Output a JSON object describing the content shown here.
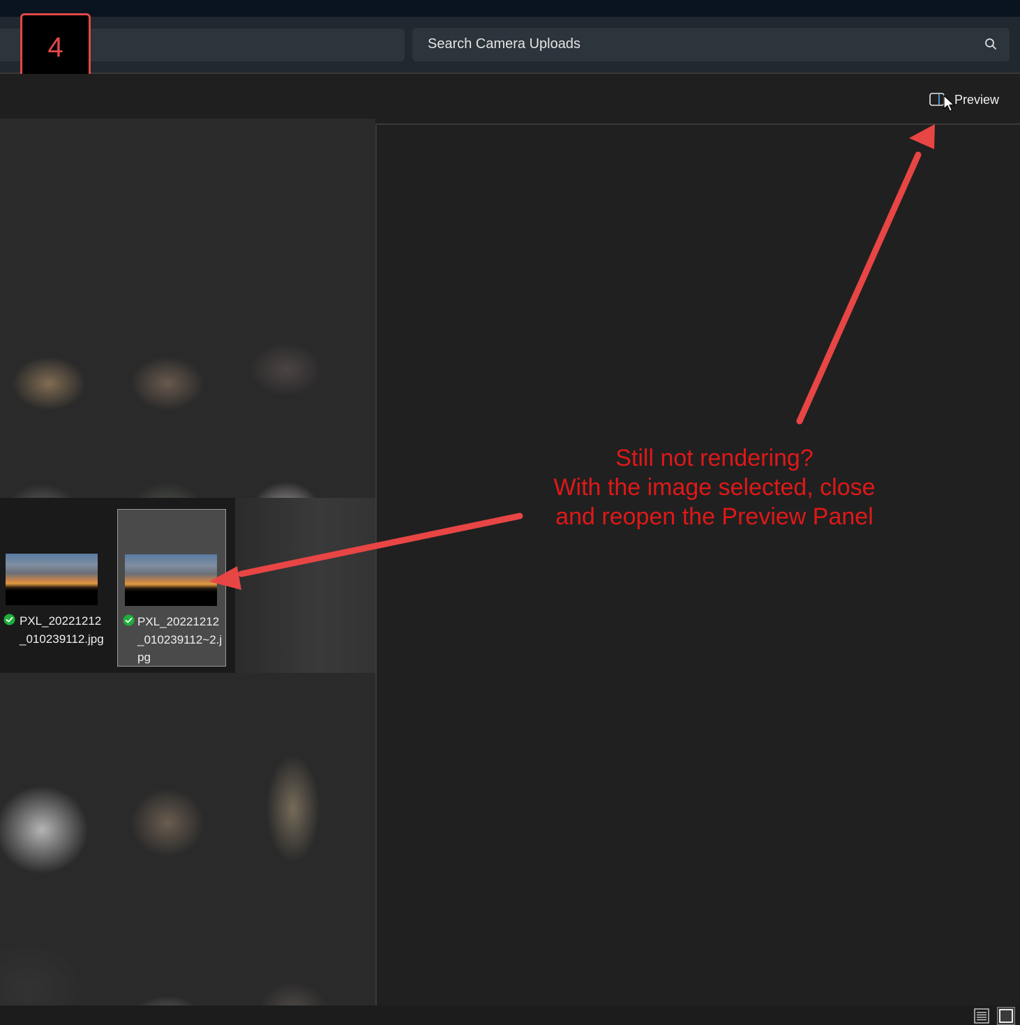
{
  "step": {
    "number": "4"
  },
  "search": {
    "placeholder": "Search Camera Uploads"
  },
  "commandbar": {
    "preview_label": "Preview"
  },
  "files": [
    {
      "name": "PXL_20221212_010239112.jpg",
      "selected": false,
      "status": "synced"
    },
    {
      "name": "PXL_20221212_010239112~2.jpg",
      "selected": true,
      "status": "synced"
    }
  ],
  "annotation": {
    "lines": [
      "Still not rendering?",
      "With the image selected, close",
      "and reopen the Preview Panel"
    ]
  },
  "colors": {
    "annotation": "#e01818",
    "badge_border": "#e34848",
    "arrow": "#e84545",
    "sync_ok": "#1fae3c"
  }
}
